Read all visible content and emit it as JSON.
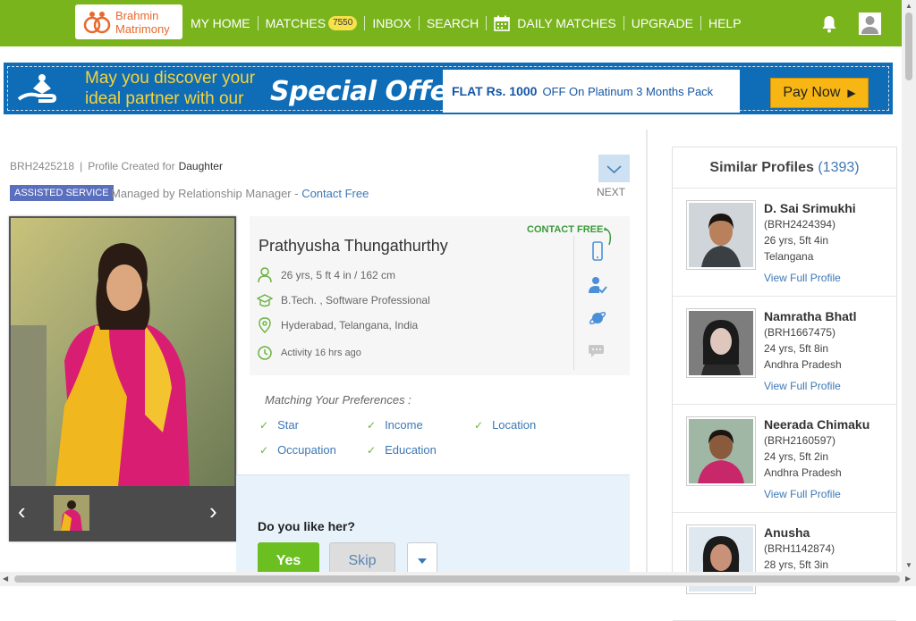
{
  "brand": {
    "line1": "Brahmin",
    "line2": "Matrimony"
  },
  "nav": {
    "items": [
      {
        "label": "MY HOME"
      },
      {
        "label": "MATCHES",
        "badge": "7550"
      },
      {
        "label": "INBOX"
      },
      {
        "label": "SEARCH"
      },
      {
        "label": "DAILY MATCHES",
        "icon": "calendar-icon"
      },
      {
        "label": "UPGRADE"
      },
      {
        "label": "HELP"
      }
    ],
    "notifications_icon": "bell-icon",
    "account_icon": "user-icon"
  },
  "banner": {
    "line1": "May you discover your",
    "line2": "ideal partner with our",
    "special": "Special Offer",
    "flat": "FLAT Rs. 1000",
    "offer": "OFF On Platinum 3 Months Pack",
    "cta": "Pay Now"
  },
  "profile": {
    "id": "BRH2425218",
    "created_for_label": "Profile Created for",
    "created_for": "Daughter",
    "assisted": "ASSISTED SERVICE",
    "managed": "Managed by Relationship Manager - ",
    "contact_free_link": "Contact Free",
    "next_label": "NEXT",
    "name": "Prathyusha Thungathurthy",
    "contact_free_badge": "CONTACT FREE",
    "age_height": "26 yrs, 5 ft 4 in / 162 cm",
    "education": "B.Tech. , Software Professional",
    "location": "Hyderabad, Telangana, India",
    "activity": "Activity 16 hrs ago"
  },
  "preferences": {
    "title": "Matching Your Preferences :",
    "items": [
      "Star",
      "Income",
      "Location",
      "Occupation",
      "Education"
    ]
  },
  "like": {
    "question": "Do you like her?",
    "yes": "Yes",
    "skip": "Skip"
  },
  "similar": {
    "title": "Similar Profiles",
    "count": "(1393)",
    "link_label": "View Full Profile",
    "profiles": [
      {
        "name": "D. Sai Srimukhi",
        "id": "(BRH2424394)",
        "age": "26 yrs, 5ft 4in",
        "state": "Telangana"
      },
      {
        "name": "Namratha Bhatl",
        "id": "(BRH1667475)",
        "age": "24 yrs, 5ft 8in",
        "state": "Andhra Pradesh"
      },
      {
        "name": "Neerada Chimaku",
        "id": "(BRH2160597)",
        "age": "24 yrs, 5ft 2in",
        "state": "Andhra Pradesh"
      },
      {
        "name": "Anusha",
        "id": "(BRH1142874)",
        "age": "28 yrs, 5ft 3in",
        "state": ""
      }
    ]
  },
  "colors": {
    "nav_green": "#7ab41d",
    "banner_blue": "#0f6cb6",
    "link_blue": "#3d78b5",
    "yes_green": "#6cbf20"
  }
}
